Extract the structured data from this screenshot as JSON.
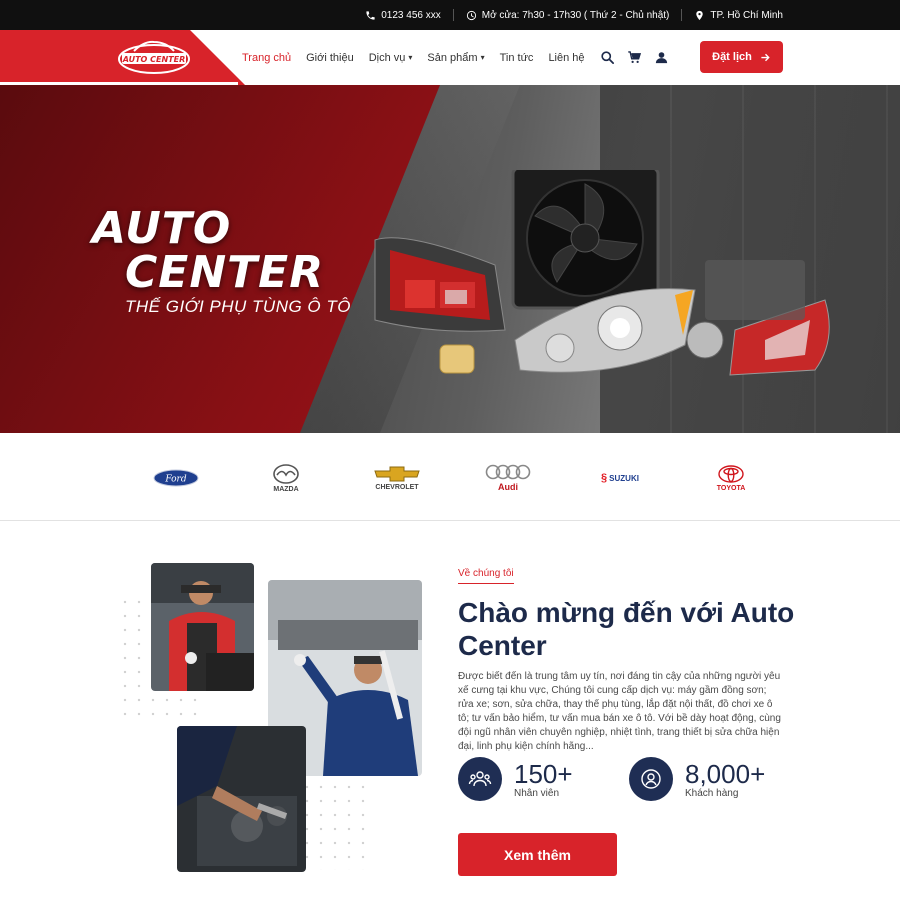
{
  "topbar": {
    "phone": "0123 456 xxx",
    "hours": "Mở cửa: 7h30 - 17h30 ( Thứ 2 - Chủ nhật)",
    "location": "TP. Hồ Chí Minh"
  },
  "header": {
    "logo_text": "AUTO CENTER",
    "nav": [
      {
        "label": "Trang chủ",
        "active": true
      },
      {
        "label": "Giới thiệu"
      },
      {
        "label": "Dịch vụ",
        "dropdown": true
      },
      {
        "label": "Sản phẩm",
        "dropdown": true
      },
      {
        "label": "Tin tức"
      },
      {
        "label": "Liên hệ"
      }
    ],
    "book_label": "Đặt lịch",
    "icons": [
      "search-icon",
      "cart-icon",
      "user-icon"
    ]
  },
  "hero": {
    "title_line1": "AUTO",
    "title_line2": "CENTER",
    "subtitle": "THẾ GIỚI PHỤ TÙNG Ô TÔ"
  },
  "brands": [
    "Ford",
    "MAZDA",
    "CHEVROLET",
    "Audi",
    "SUZUKI",
    "TOYOTA"
  ],
  "about": {
    "label": "Về chúng tôi",
    "title": "Chào mừng đến với Auto Center",
    "text": "Được biết đến là trung tâm uy tín, nơi đáng tin cậy của những người yêu xế cưng tại khu vực, Chúng tôi cung cấp dịch vụ: máy gầm đồng sơn; rửa xe; sơn, sửa chữa, thay thế phụ tùng, lắp đặt nội thất, đồ chơi xe ô tô; tư vấn bảo hiểm, tư vấn mua bán xe ô tô. Với bề dày hoạt động, cùng đội ngũ nhân viên chuyên nghiệp, nhiệt tình, trang thiết bị sửa chữa hiện đại, linh phụ kiện chính hãng...",
    "stats": [
      {
        "value": "150+",
        "label": "Nhân viên",
        "icon": "team-icon"
      },
      {
        "value": "8,000+",
        "label": "Khách hàng",
        "icon": "customer-icon"
      }
    ],
    "more_label": "Xem thêm"
  },
  "colors": {
    "accent": "#d8232a",
    "navy": "#1f2e54",
    "topbar": "#101010"
  }
}
